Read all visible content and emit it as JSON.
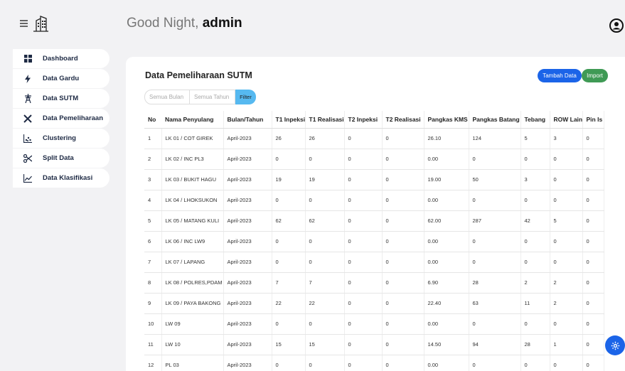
{
  "header": {
    "greeting_prefix": "Good Night,",
    "user": "admin"
  },
  "sidebar": {
    "items": [
      {
        "label": "Dashboard",
        "icon": "dashboard-icon"
      },
      {
        "label": "Data Gardu",
        "icon": "bolt-icon"
      },
      {
        "label": "Data SUTM",
        "icon": "tower-icon"
      },
      {
        "label": "Data Pemeliharaan",
        "icon": "tools-icon"
      },
      {
        "label": "Clustering",
        "icon": "cluster-icon"
      },
      {
        "label": "Split Data",
        "icon": "scissors-icon"
      },
      {
        "label": "Data Klasifikasi",
        "icon": "chart-line-icon"
      }
    ]
  },
  "main": {
    "title": "Data Pemeliharaan SUTM",
    "tambah_label": "Tambah Data",
    "import_label": "Import",
    "filter_bulan": "Semua Bulan",
    "filter_tahun": "Semua Tahun",
    "filter_label": "Filter"
  },
  "table": {
    "headers": [
      "No",
      "Nama Penyulang",
      "Bulan/Tahun",
      "T1 Inpeksi",
      "T1 Realisasi",
      "T2 Inpeksi",
      "T2 Realisasi",
      "Pangkas KMS",
      "Pangkas Batang",
      "Tebang",
      "ROW Lain",
      "Pin Is"
    ],
    "rows": [
      [
        "1",
        "LK 01 / COT GIREK",
        "April-2023",
        "26",
        "26",
        "0",
        "0",
        "26.10",
        "124",
        "5",
        "3",
        "0"
      ],
      [
        "2",
        "LK 02 / INC PL3",
        "April-2023",
        "0",
        "0",
        "0",
        "0",
        "0.00",
        "0",
        "0",
        "0",
        "0"
      ],
      [
        "3",
        "LK 03 / BUKIT HAGU",
        "April-2023",
        "19",
        "19",
        "0",
        "0",
        "19.00",
        "50",
        "3",
        "0",
        "0"
      ],
      [
        "4",
        "LK 04 / LHOKSUKON",
        "April-2023",
        "0",
        "0",
        "0",
        "0",
        "0.00",
        "0",
        "0",
        "0",
        "0"
      ],
      [
        "5",
        "LK 05 / MATANG KULI",
        "April-2023",
        "62",
        "62",
        "0",
        "0",
        "62.00",
        "287",
        "42",
        "5",
        "0"
      ],
      [
        "6",
        "LK 06 / INC LW9",
        "April-2023",
        "0",
        "0",
        "0",
        "0",
        "0.00",
        "0",
        "0",
        "0",
        "0"
      ],
      [
        "7",
        "LK 07 / LAPANG",
        "April-2023",
        "0",
        "0",
        "0",
        "0",
        "0.00",
        "0",
        "0",
        "0",
        "0"
      ],
      [
        "8",
        "LK 08 / POLRES,PDAM",
        "April-2023",
        "7",
        "7",
        "0",
        "0",
        "6.90",
        "28",
        "2",
        "2",
        "0"
      ],
      [
        "9",
        "LK 09 / PAYA BAKONG",
        "April-2023",
        "22",
        "22",
        "0",
        "0",
        "22.40",
        "63",
        "11",
        "2",
        "0"
      ],
      [
        "10",
        "LW 09",
        "April-2023",
        "0",
        "0",
        "0",
        "0",
        "0.00",
        "0",
        "0",
        "0",
        "0"
      ],
      [
        "11",
        "LW 10",
        "April-2023",
        "15",
        "15",
        "0",
        "0",
        "14.50",
        "94",
        "28",
        "1",
        "0"
      ],
      [
        "12",
        "PL 03",
        "April-2023",
        "0",
        "0",
        "0",
        "0",
        "0.00",
        "0",
        "0",
        "0",
        "0"
      ]
    ]
  },
  "colors": {
    "primary": "#1b64e8",
    "success": "#3f9a55",
    "filter": "#56b9f0"
  }
}
